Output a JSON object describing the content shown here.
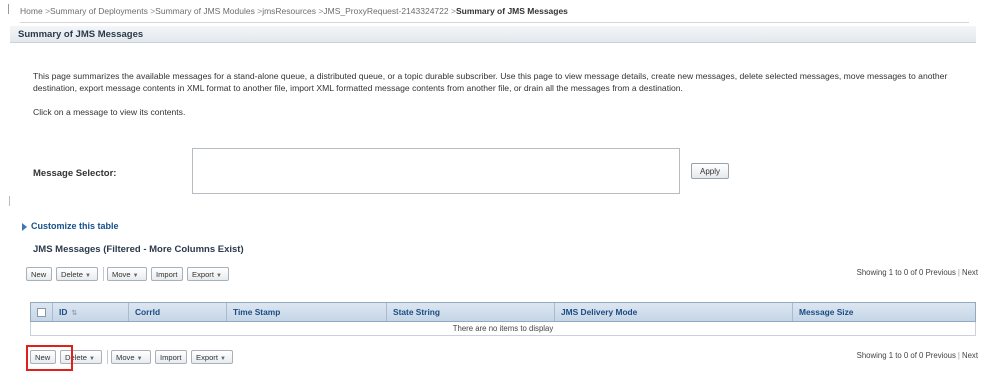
{
  "breadcrumb": {
    "items": [
      "Home",
      "Summary of Deployments",
      "Summary of JMS Modules",
      "jmsResources",
      "JMS_ProxyRequest-2143324722"
    ],
    "current": "Summary of JMS Messages",
    "separator": ">"
  },
  "page": {
    "title": "Summary of JMS Messages",
    "description": "This page summarizes the available messages for a stand-alone queue, a distributed queue, or a topic durable subscriber. Use this page to view message details, create new messages, delete selected messages, move messages to another destination, export message contents in XML format to another file, import XML formatted message contents from another file, or drain all the messages from a destination.",
    "click_hint": "Click on a message to view its contents."
  },
  "selector": {
    "label": "Message Selector:",
    "value": "",
    "apply_label": "Apply"
  },
  "customize_label": "Customize this table",
  "table": {
    "title": "JMS Messages (Filtered - More Columns Exist)",
    "toolbar": {
      "new_label": "New",
      "delete_label": "Delete",
      "move_label": "Move",
      "import_label": "Import",
      "export_label": "Export",
      "status": "Showing 1 to 0 of 0",
      "previous_label": "Previous",
      "next_label": "Next"
    },
    "columns": [
      "ID",
      "CorrId",
      "Time Stamp",
      "State String",
      "JMS Delivery Mode",
      "Message Size"
    ],
    "empty_message": "There are no items to display"
  },
  "colors": {
    "header_text": "#1c4c83",
    "link": "#15518c",
    "highlight": "#e0201a"
  }
}
